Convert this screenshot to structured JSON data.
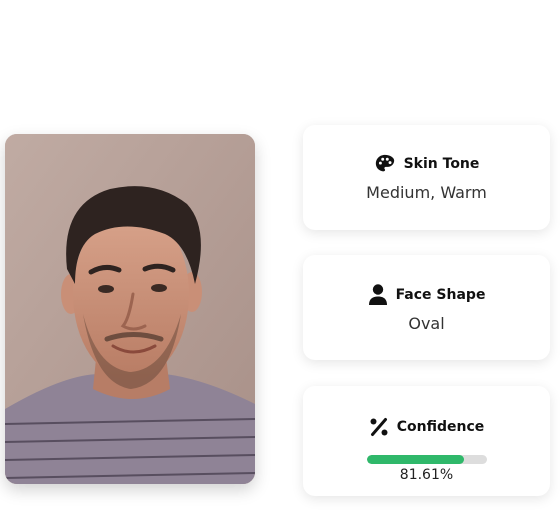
{
  "skin_tone": {
    "title": "Skin Tone",
    "value": "Medium, Warm",
    "icon": "palette-icon"
  },
  "face_shape": {
    "title": "Face Shape",
    "value": "Oval",
    "icon": "user-icon"
  },
  "confidence": {
    "title": "Confidence",
    "value": "81.61%",
    "percent": 81.61,
    "icon": "percent-icon",
    "bar_color": "#2fb86a"
  }
}
